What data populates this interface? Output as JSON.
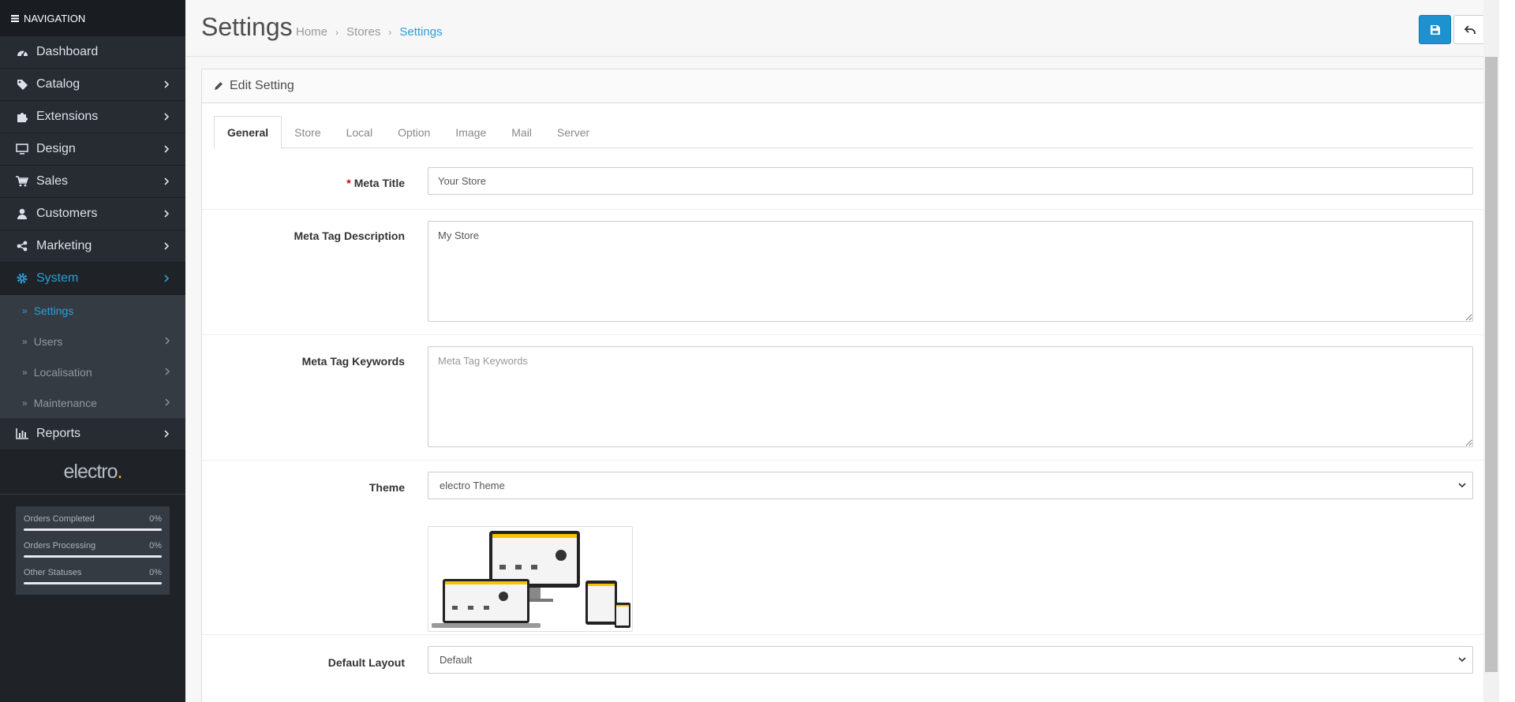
{
  "nav": {
    "header": "NAVIGATION",
    "items": [
      {
        "label": "Dashboard",
        "icon": "dashboard-icon"
      },
      {
        "label": "Catalog",
        "icon": "tags-icon"
      },
      {
        "label": "Extensions",
        "icon": "puzzle-icon"
      },
      {
        "label": "Design",
        "icon": "monitor-icon"
      },
      {
        "label": "Sales",
        "icon": "cart-icon"
      },
      {
        "label": "Customers",
        "icon": "user-icon"
      },
      {
        "label": "Marketing",
        "icon": "share-icon"
      },
      {
        "label": "System",
        "icon": "gear-icon"
      }
    ],
    "system_sub": [
      "Settings",
      "Users",
      "Localisation",
      "Maintenance"
    ],
    "reports": {
      "label": "Reports",
      "icon": "bar-chart-icon"
    },
    "logo": {
      "text": "electro",
      "dot": "."
    },
    "stats": [
      {
        "label": "Orders Completed",
        "value": "0%",
        "fraction": 0
      },
      {
        "label": "Orders Processing",
        "value": "0%",
        "fraction": 0
      },
      {
        "label": "Other Statuses",
        "value": "0%",
        "fraction": 0
      }
    ]
  },
  "header": {
    "title": "Settings",
    "breadcrumbs": [
      "Home",
      "Stores",
      "Settings"
    ],
    "separator": "›"
  },
  "panel": {
    "title": "Edit Setting",
    "tabs": [
      "General",
      "Store",
      "Local",
      "Option",
      "Image",
      "Mail",
      "Server"
    ]
  },
  "form": {
    "required_mark": "*",
    "meta_title": {
      "label": "Meta Title",
      "value": "Your Store"
    },
    "meta_description": {
      "label": "Meta Tag Description",
      "value": "My Store"
    },
    "meta_keywords": {
      "label": "Meta Tag Keywords",
      "value": "",
      "placeholder": "Meta Tag Keywords"
    },
    "theme": {
      "label": "Theme",
      "value": "electro Theme"
    },
    "layout": {
      "label": "Default Layout",
      "value": "Default"
    }
  },
  "colors": {
    "accent": "#1e91cf",
    "sidebar": "#1f2328",
    "logo_dot": "#f7c500"
  }
}
